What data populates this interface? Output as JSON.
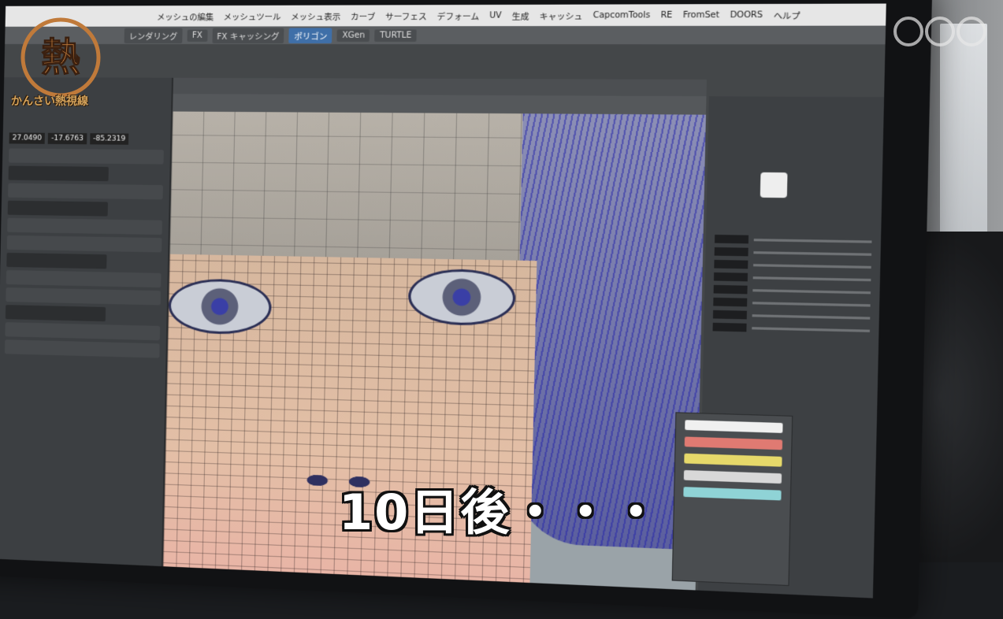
{
  "photo": {
    "subject": "3D modeling software on a monitor showing a wireframe face",
    "colors": {
      "hair_blue": "#3b3fa8",
      "skin": "#e3bfa6",
      "caption_text": "#ffffff",
      "logo_copper": "#c07a3a"
    }
  },
  "program_logo": {
    "glyph": "熱",
    "subtitle": "かんさい熱視線"
  },
  "broadcaster_logo": {
    "icon": "nhk-logo-icon"
  },
  "caption": {
    "text": "10日後・・・"
  },
  "app": {
    "menu_items": [
      "メッシュの編集",
      "メッシュツール",
      "メッシュ表示",
      "カーブ",
      "サーフェス",
      "デフォーム",
      "UV",
      "生成",
      "キャッシュ",
      "CapcomTools",
      "RE",
      "FromSet",
      "DOORS",
      "ヘルプ"
    ],
    "shelf_tabs": [
      "レンダリング",
      "FX",
      "FX キャッシング",
      "ポリゴン",
      "XGen",
      "TURTLE"
    ],
    "active_shelf_tab_index": 3,
    "coords": [
      "27.0490",
      "-17.6763",
      "-85.2319"
    ]
  }
}
